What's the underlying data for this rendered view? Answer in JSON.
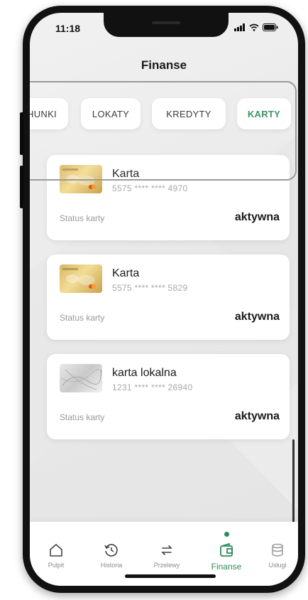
{
  "status_bar": {
    "time": "11:18"
  },
  "header": {
    "title": "Finanse"
  },
  "tabs": [
    {
      "label": "HUNKI",
      "active": false
    },
    {
      "label": "LOKATY",
      "active": false
    },
    {
      "label": "KREDYTY",
      "active": false
    },
    {
      "label": "KARTY",
      "active": true
    }
  ],
  "cards": [
    {
      "name": "Karta",
      "number": "5575 **** **** 4970",
      "status_label": "Status karty",
      "status": "aktywna",
      "image": "gold-card-image"
    },
    {
      "name": "Karta",
      "number": "5575 **** **** 5829",
      "status_label": "Status karty",
      "status": "aktywna",
      "image": "gold-card-image"
    },
    {
      "name": "karta lokalna",
      "number": "1231 **** **** 26940",
      "status_label": "Status karty",
      "status": "aktywna",
      "image": "gray-card-image"
    }
  ],
  "nav": {
    "items": [
      {
        "label": "Pulpit",
        "icon": "home-icon"
      },
      {
        "label": "Historia",
        "icon": "history-icon"
      },
      {
        "label": "Przelewy",
        "icon": "transfer-icon"
      },
      {
        "label": "Finanse",
        "icon": "wallet-icon",
        "active": true
      },
      {
        "label": "Usługi",
        "icon": "database-icon"
      }
    ]
  },
  "colors": {
    "accent": "#2e8b57",
    "card_gold": "#d8b664"
  }
}
